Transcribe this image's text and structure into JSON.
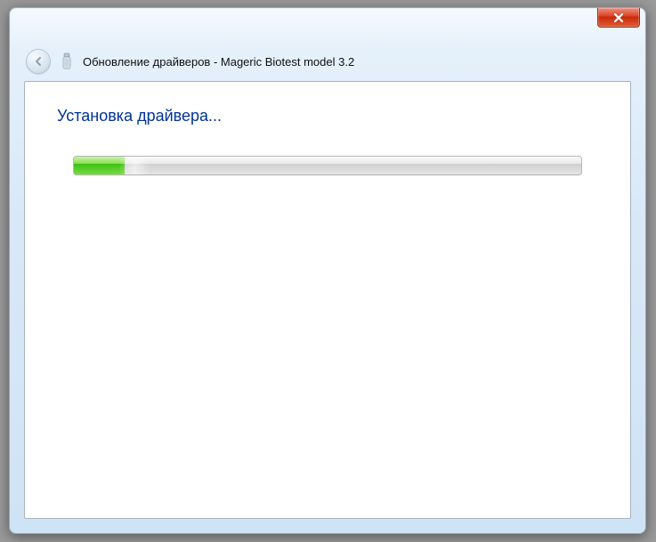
{
  "window": {
    "title": "Обновление драйверов - Mageric Biotest model 3.2"
  },
  "content": {
    "heading": "Установка драйвера...",
    "progress_percent": 10
  }
}
